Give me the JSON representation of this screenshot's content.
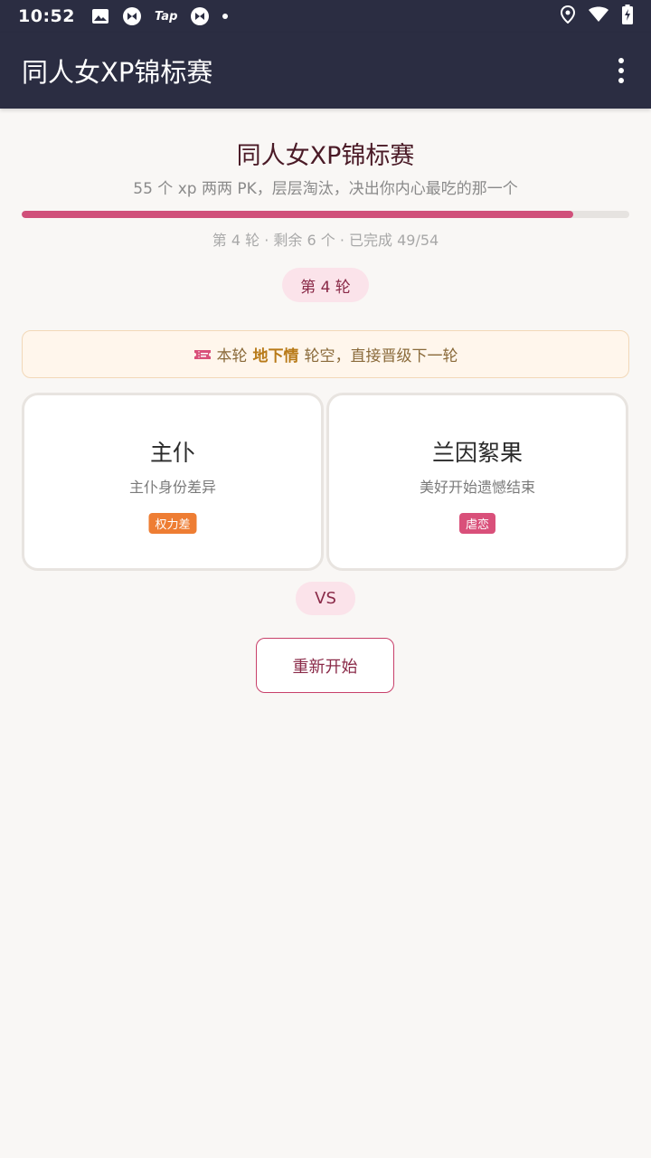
{
  "status_bar": {
    "time": "10:52",
    "tap_label": "Tap",
    "icons": [
      "image-icon",
      "app-icon",
      "tap-icon",
      "app-icon",
      "dot-icon",
      "location-icon",
      "wifi-icon",
      "battery-icon"
    ]
  },
  "app_bar": {
    "title": "同人女XP锦标赛",
    "menu_icon": "more-vert-icon"
  },
  "header": {
    "title": "同人女XP锦标赛",
    "subtitle": "55 个 xp 两两 PK，层层淘汰，决出你内心最吃的那一个",
    "progress_percent": 90.7,
    "progress_text": "第 4 轮 · 剩余 6 个 · 已完成 49/54"
  },
  "round_badge": "第 4 轮",
  "notice": {
    "icon": "ticket-icon",
    "prefix": "本轮",
    "highlight": "地下情",
    "suffix": "轮空，直接晋级下一轮"
  },
  "cards": [
    {
      "title": "主仆",
      "desc": "主仆身份差异",
      "tag": "权力差",
      "tag_color": "#ee7d33"
    },
    {
      "title": "兰因絮果",
      "desc": "美好开始遗憾结束",
      "tag": "虐恋",
      "tag_color": "#d9507a"
    }
  ],
  "vs_label": "VS",
  "restart_label": "重新开始",
  "colors": {
    "bar_background": "#2b2d42",
    "accent": "#d0507a",
    "page_background": "#f9f7f5"
  }
}
